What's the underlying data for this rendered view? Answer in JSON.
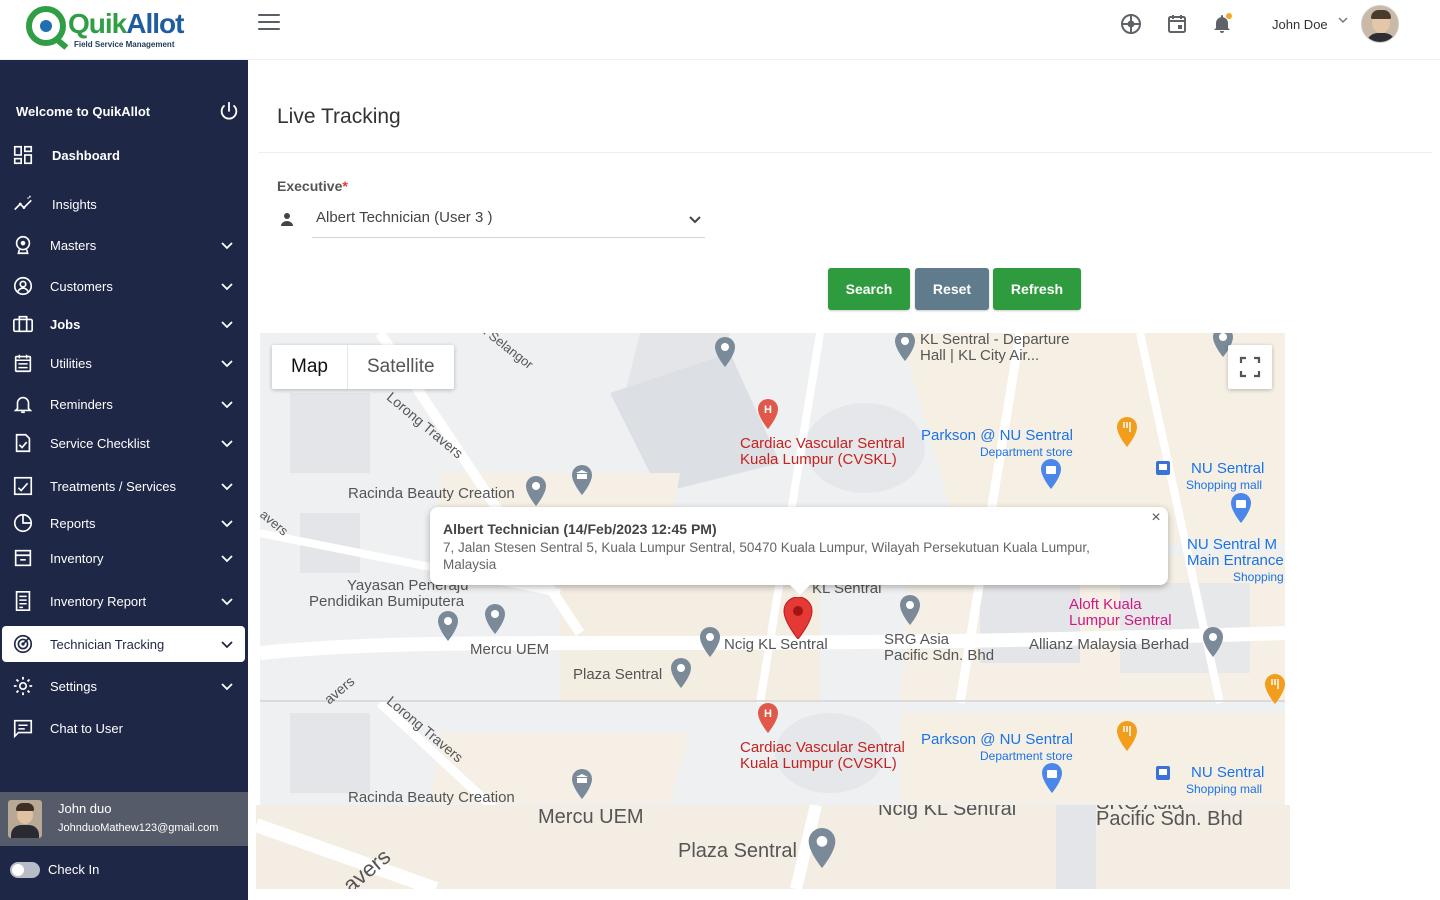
{
  "app": {
    "logo_main": "Quik",
    "logo_accent": "Allot",
    "logo_tagline": "Field Service Management"
  },
  "header": {
    "user_name": "John Doe"
  },
  "sidebar": {
    "welcome": "Welcome to QuikAllot",
    "items": [
      {
        "label": "Dashboard",
        "icon": "dashboard-icon"
      },
      {
        "label": "Insights",
        "icon": "insights-icon"
      },
      {
        "label": "Masters",
        "icon": "masters-icon"
      },
      {
        "label": "Customers",
        "icon": "customers-icon"
      },
      {
        "label": "Jobs",
        "icon": "jobs-icon"
      },
      {
        "label": "Utilities",
        "icon": "utilities-icon"
      },
      {
        "label": "Reminders",
        "icon": "bell-icon"
      },
      {
        "label": "Service Checklist",
        "icon": "checklist-icon"
      },
      {
        "label": "Treatments / Services",
        "icon": "treatments-icon"
      },
      {
        "label": "Reports",
        "icon": "reports-icon"
      },
      {
        "label": "Inventory",
        "icon": "inventory-icon"
      },
      {
        "label": "Inventory Report",
        "icon": "inventory-report-icon"
      },
      {
        "label": "Technician Tracking",
        "icon": "tracking-icon"
      },
      {
        "label": "Settings",
        "icon": "settings-icon"
      },
      {
        "label": "Chat to User",
        "icon": "chat-icon"
      }
    ],
    "user": {
      "name": "John duo",
      "email": "JohnduoMathew123@gmail.com"
    },
    "checkin_label": "Check In"
  },
  "page": {
    "title": "Live Tracking",
    "executive_label": "Executive",
    "executive_required": "*",
    "executive_value": "Albert Technician (User 3 )",
    "buttons": {
      "search": "Search",
      "reset": "Reset",
      "refresh": "Refresh"
    }
  },
  "map": {
    "tab_map": "Map",
    "tab_satellite": "Satellite",
    "info_title": "Albert Technician (14/Feb/2023 12:45 PM)",
    "info_address": "7, Jalan Stesen Sentral 5, Kuala Lumpur Sentral, 50470 Kuala Lumpur, Wilayah Persekutuan Kuala Lumpur, Malaysia",
    "labels": {
      "kl_sentral_departure": "KL Sentral - Departure",
      "kl_sentral_departure_2": "Hall | KL City Air...",
      "cardiac_1": "Cardiac Vascular Sentral",
      "cardiac_2": "Kuala Lumpur (CVSKL)",
      "parkson": "Parkson @ NU Sentral",
      "parkson_sub": "Department store",
      "nu_sentral": "NU Sentral",
      "nu_sentral_sub": "Shopping mall",
      "nu_sentral_main": "NU Sentral M",
      "nu_sentral_main_2": "Main Entrance",
      "nu_sentral_main_3": "Shopping",
      "racinda": "Racinda Beauty Creation",
      "lorong": "Lorong Travers",
      "selangor": "n Selangor",
      "travers": "avers",
      "yayasan": "Yayasan Peneraju",
      "yayasan_2": "Pendidikan Bumiputera",
      "mercu": "Mercu UEM",
      "kl_sentral": "KL Sentral",
      "ncig": "Ncig KL Sentral",
      "srg": "SRG Asia",
      "srg_2": "Pacific Sdn. Bhd",
      "aloft": "Aloft Kuala",
      "aloft_2": "Lumpur Sentral",
      "allianz": "Allianz Malaysia Berhad",
      "plaza": "Plaza Sentral",
      "srg_asia": "SRG Asia"
    }
  }
}
